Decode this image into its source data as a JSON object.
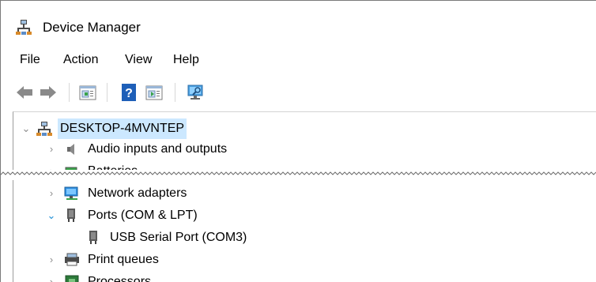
{
  "window": {
    "title": "Device Manager"
  },
  "menu": {
    "file": "File",
    "action": "Action",
    "view": "View",
    "help": "Help"
  },
  "toolbar": {
    "back": "arrow-left-icon",
    "forward": "arrow-right-icon",
    "properties": "properties-sheet-icon",
    "help": "help-question-icon",
    "update": "update-driver-icon",
    "scan": "scan-monitor-icon"
  },
  "tree": {
    "root": "DESKTOP-4MVNTEP",
    "items": [
      "Audio inputs and outputs",
      "Batteries",
      "Network adapters",
      "Ports (COM & LPT)",
      "USB Serial Port (COM3)",
      "Print queues",
      "Processors"
    ]
  }
}
